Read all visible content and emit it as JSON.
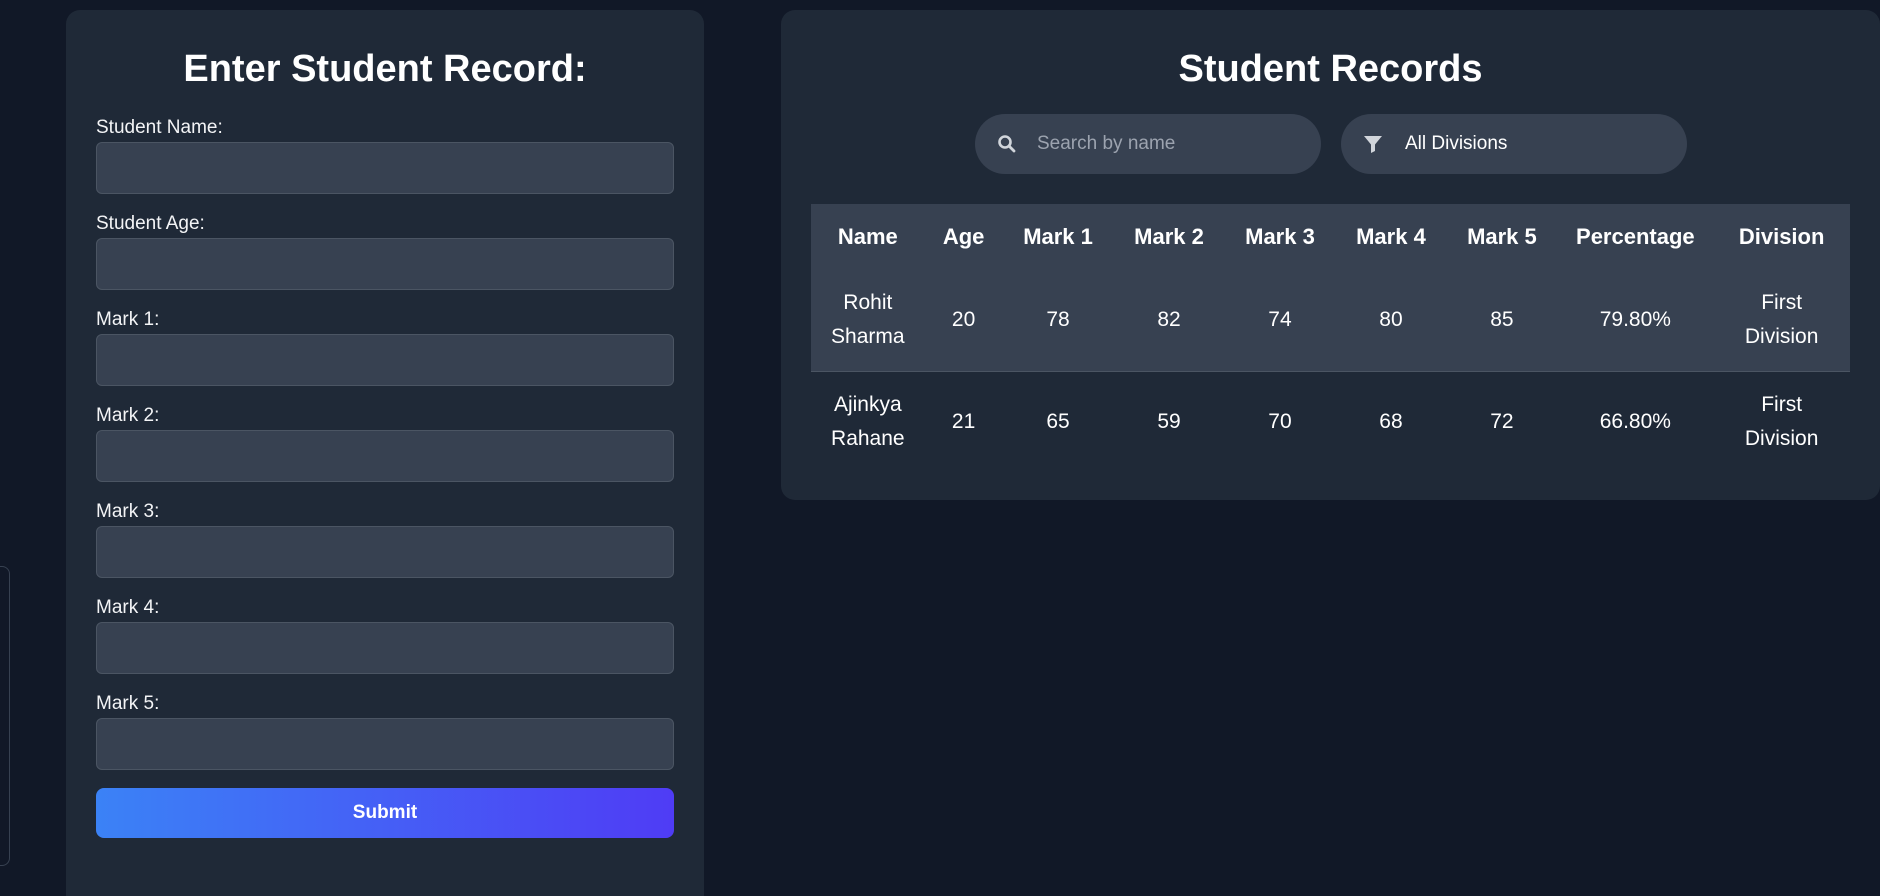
{
  "form": {
    "title": "Enter Student Record:",
    "fields": [
      {
        "label": "Student Name:",
        "value": ""
      },
      {
        "label": "Student Age:",
        "value": ""
      },
      {
        "label": "Mark 1:",
        "value": ""
      },
      {
        "label": "Mark 2:",
        "value": ""
      },
      {
        "label": "Mark 3:",
        "value": ""
      },
      {
        "label": "Mark 4:",
        "value": ""
      },
      {
        "label": "Mark 5:",
        "value": ""
      }
    ],
    "submit_label": "Submit"
  },
  "records": {
    "title": "Student Records",
    "search": {
      "placeholder": "Search by name",
      "value": "",
      "icon": "search-icon"
    },
    "filter": {
      "selected": "All Divisions",
      "icon": "filter-icon"
    },
    "columns": [
      "Name",
      "Age",
      "Mark 1",
      "Mark 2",
      "Mark 3",
      "Mark 4",
      "Mark 5",
      "Percentage",
      "Division"
    ],
    "rows": [
      {
        "name_first": "Rohit",
        "name_last": "Sharma",
        "age": "20",
        "mark1": "78",
        "mark2": "82",
        "mark3": "74",
        "mark4": "80",
        "mark5": "85",
        "percentage": "79.80%",
        "division_first": "First",
        "division_last": "Division"
      },
      {
        "name_first": "Ajinkya",
        "name_last": "Rahane",
        "age": "21",
        "mark1": "65",
        "mark2": "59",
        "mark3": "70",
        "mark4": "68",
        "mark5": "72",
        "percentage": "66.80%",
        "division_first": "First",
        "division_last": "Division"
      }
    ]
  },
  "colors": {
    "background": "#111827",
    "panel": "#1f2937",
    "input": "#374151",
    "button_start": "#3b82f6",
    "button_end": "#4f3cf5"
  }
}
